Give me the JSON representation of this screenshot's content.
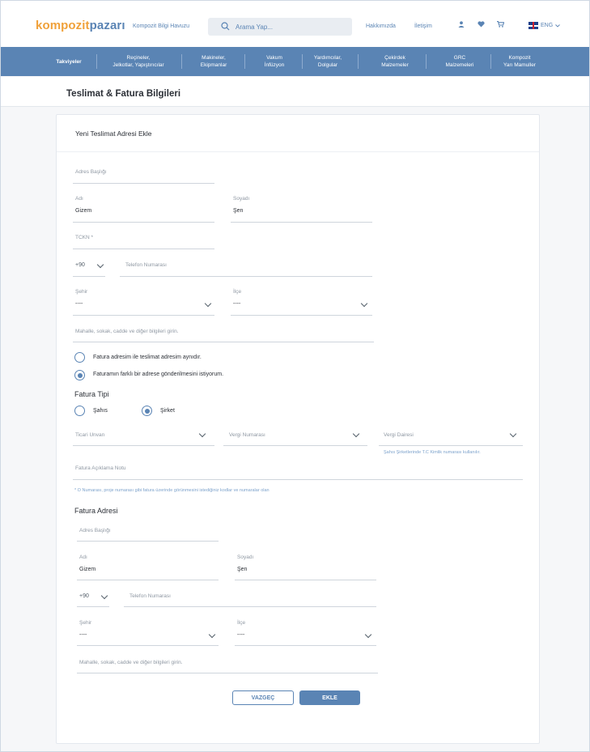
{
  "header": {
    "logo_a": "kompozit",
    "logo_b": "pazarı",
    "bilgi_havuzu": "Kompozit Bilgi Havuzu",
    "search_placeholder": "Arama Yap...",
    "hakkimizda": "Hakkımızda",
    "iletisim": "İletişim",
    "lang": "ENG",
    "icons": [
      "user-icon",
      "heart-icon",
      "cart-icon"
    ]
  },
  "nav": {
    "items": [
      {
        "label": "Takviyeler"
      },
      {
        "label": "Reçineler,\nJelkotlar, Yapıştırıcılar"
      },
      {
        "label": "Makineler,\nEkipmanlar"
      },
      {
        "label": "Vakum\nİnfüzyon"
      },
      {
        "label": "Yardımcılar,\nDolgular"
      },
      {
        "label": "Çekirdek\nMalzemeler"
      },
      {
        "label": "GRC\nMalzemeleri"
      },
      {
        "label": "Kompozit\nYarı Mamuller"
      }
    ]
  },
  "page": {
    "title": "Teslimat & Fatura Bilgileri",
    "card_title": "Yeni Teslimat Adresi Ekle"
  },
  "delivery": {
    "address_title": "Adres Başlığı",
    "first_name_label": "Adı",
    "first_name": "Gizem",
    "last_name_label": "Soyadı",
    "last_name": "Şen",
    "tckn": "TCKN *",
    "phone_code": "+90",
    "phone_placeholder": "Telefon Numarası",
    "city_label": "Şehir",
    "city_value": "----",
    "district_label": "İlçe",
    "district_value": "----",
    "address_placeholder": "Mahalle, sokak, cadde ve diğer bilgileri girin."
  },
  "options": {
    "same_address": "Fatura adresim ile teslimat adresim aynıdır.",
    "different_address": "Faturamın farklı bir adrese gönderilmesini istiyorum."
  },
  "invoice_type": {
    "title": "Fatura Tipi",
    "personal": "Şahıs",
    "company": "Şirket"
  },
  "company": {
    "title_label": "Ticari Unvan",
    "tax_number": "Vergi Numarası",
    "tax_office": "Vergi Dairesi",
    "tax_hint": "Şahıs Şirketlerinde T.C Kimlik numarası kullanılır.",
    "note_placeholder": "Fatura Açıklama Notu",
    "note_hint": "* O Numarası, proje numarası gibi fatura üzerinde görünmesini istediğiniz kodlar ve numaralar olan"
  },
  "invoice_address": {
    "title": "Fatura Adresi",
    "address_title": "Adres Başlığı",
    "first_name_label": "Adı",
    "first_name": "Gizem",
    "last_name_label": "Soyadı",
    "last_name": "Şen",
    "phone_code": "+90",
    "phone_placeholder": "Telefon Numarası",
    "city_label": "Şehir",
    "city_value": "----",
    "district_label": "İlçe",
    "district_value": "----",
    "address_placeholder": "Mahalle, sokak, cadde ve diğer bilgileri girin."
  },
  "actions": {
    "cancel": "VAZGEÇ",
    "add": "EKLE"
  },
  "colors": {
    "brand_blue": "#5a84b4",
    "brand_orange": "#f0a13a"
  }
}
